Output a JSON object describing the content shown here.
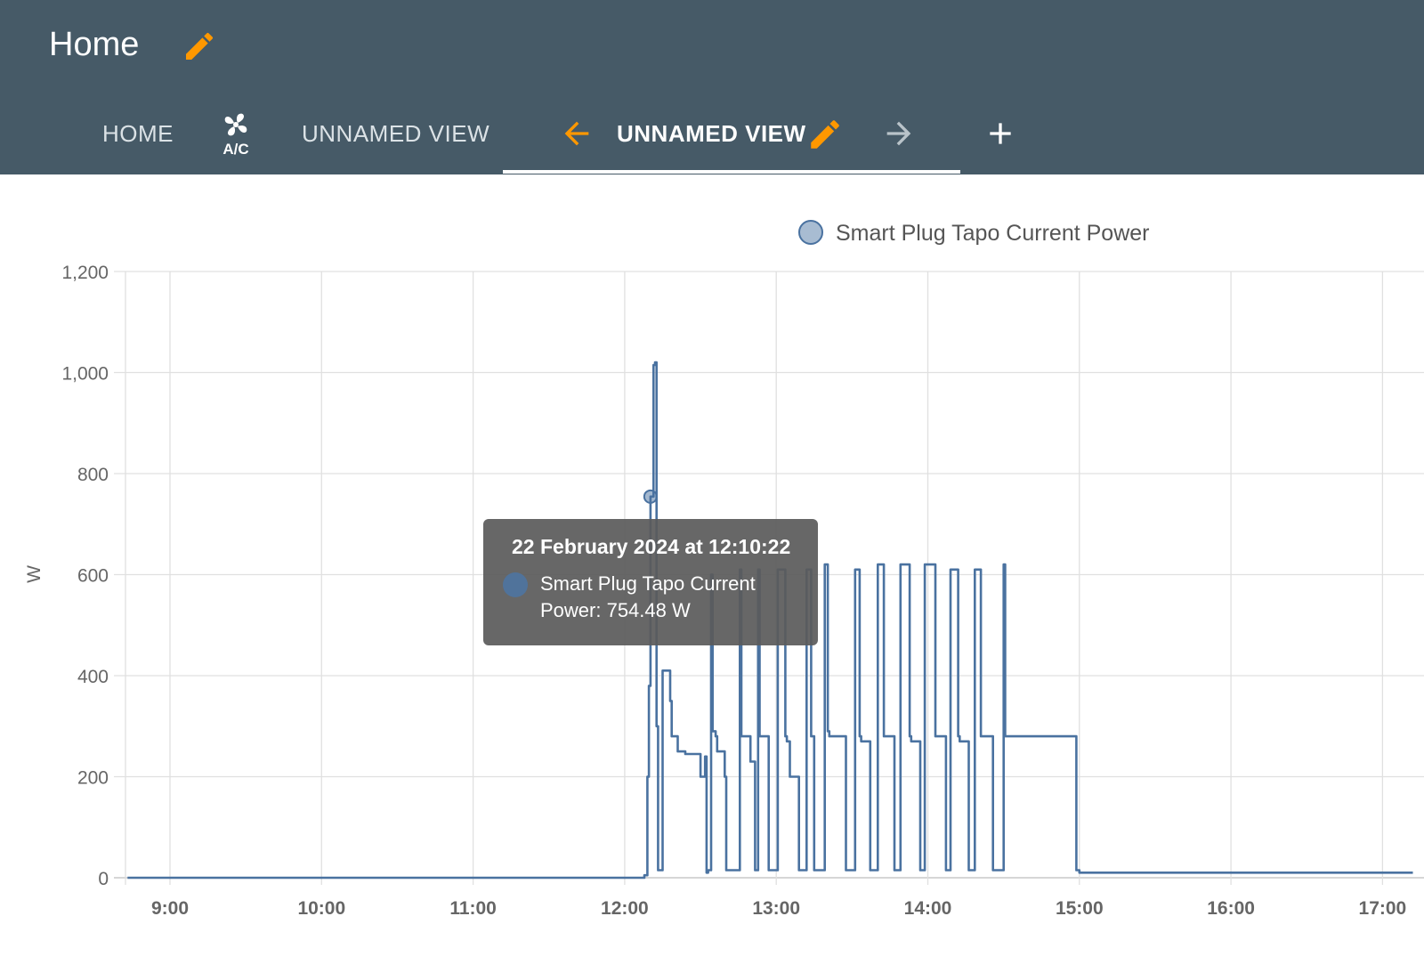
{
  "header": {
    "title": "Home",
    "tabs": [
      {
        "label": "HOME"
      },
      {
        "label": "A/C",
        "icon": "fan-icon"
      },
      {
        "label": "UNNAMED VIEW"
      },
      {
        "label": "UNNAMED VIEW",
        "active": true
      }
    ],
    "accent_color": "#ff9800",
    "bar_color": "#465a67"
  },
  "chart_data": {
    "type": "line",
    "legend": "Smart Plug Tapo Current Power",
    "legend_position": "top-center",
    "ylabel": "W",
    "ylim": [
      0,
      1200
    ],
    "yticks": [
      "0",
      "200",
      "400",
      "600",
      "800",
      "1,000",
      "1,200"
    ],
    "xticks": [
      "9:00",
      "10:00",
      "11:00",
      "12:00",
      "13:00",
      "14:00",
      "15:00",
      "16:00",
      "17:00"
    ],
    "grid": true,
    "series": [
      {
        "name": "Smart Plug Tapo Current Power",
        "color": "#4a72a0",
        "step": true,
        "x_hours": [
          8.72,
          12.13,
          12.15,
          12.16,
          12.17,
          12.19,
          12.2,
          12.21,
          12.22,
          12.23,
          12.24,
          12.25,
          12.3,
          12.31,
          12.33,
          12.35,
          12.4,
          12.5,
          12.53,
          12.54,
          12.55,
          12.57,
          12.58,
          12.6,
          12.61,
          12.62,
          12.66,
          12.67,
          12.75,
          12.76,
          12.77,
          12.8,
          12.83,
          12.86,
          12.87,
          12.88,
          12.89,
          12.94,
          12.95,
          13.0,
          13.01,
          13.06,
          13.07,
          13.09,
          13.15,
          13.16,
          13.2,
          13.23,
          13.24,
          13.25,
          13.3,
          13.32,
          13.34,
          13.35,
          13.45,
          13.46,
          13.51,
          13.52,
          13.55,
          13.56,
          13.62,
          13.63,
          13.67,
          13.71,
          13.72,
          13.78,
          13.79,
          13.82,
          13.88,
          13.89,
          13.95,
          13.96,
          13.98,
          14.05,
          14.06,
          14.12,
          14.13,
          14.15,
          14.2,
          14.21,
          14.27,
          14.28,
          14.31,
          14.35,
          14.36,
          14.43,
          14.44,
          14.5,
          14.51,
          14.55,
          14.98,
          15.0,
          17.2
        ],
        "y_watts": [
          0,
          5,
          200,
          380,
          754.48,
          1015,
          1020,
          300,
          15,
          15,
          15,
          410,
          350,
          280,
          280,
          250,
          245,
          200,
          240,
          10,
          15,
          600,
          290,
          280,
          250,
          250,
          200,
          15,
          15,
          610,
          280,
          280,
          230,
          15,
          15,
          610,
          280,
          280,
          15,
          15,
          610,
          280,
          270,
          200,
          15,
          15,
          610,
          280,
          280,
          15,
          15,
          620,
          290,
          280,
          280,
          15,
          15,
          610,
          280,
          270,
          15,
          15,
          620,
          280,
          280,
          15,
          15,
          620,
          280,
          270,
          15,
          15,
          620,
          280,
          280,
          15,
          15,
          610,
          280,
          270,
          15,
          15,
          610,
          280,
          280,
          15,
          15,
          620,
          280,
          280,
          15,
          10,
          10,
          5,
          3
        ]
      }
    ],
    "tooltip": {
      "title": "22 February 2024 at 12:10:22",
      "line1": "Smart Plug Tapo Current",
      "line2": "Power: 754.48 W",
      "x_hours": 12.17,
      "value": 754.48
    }
  }
}
